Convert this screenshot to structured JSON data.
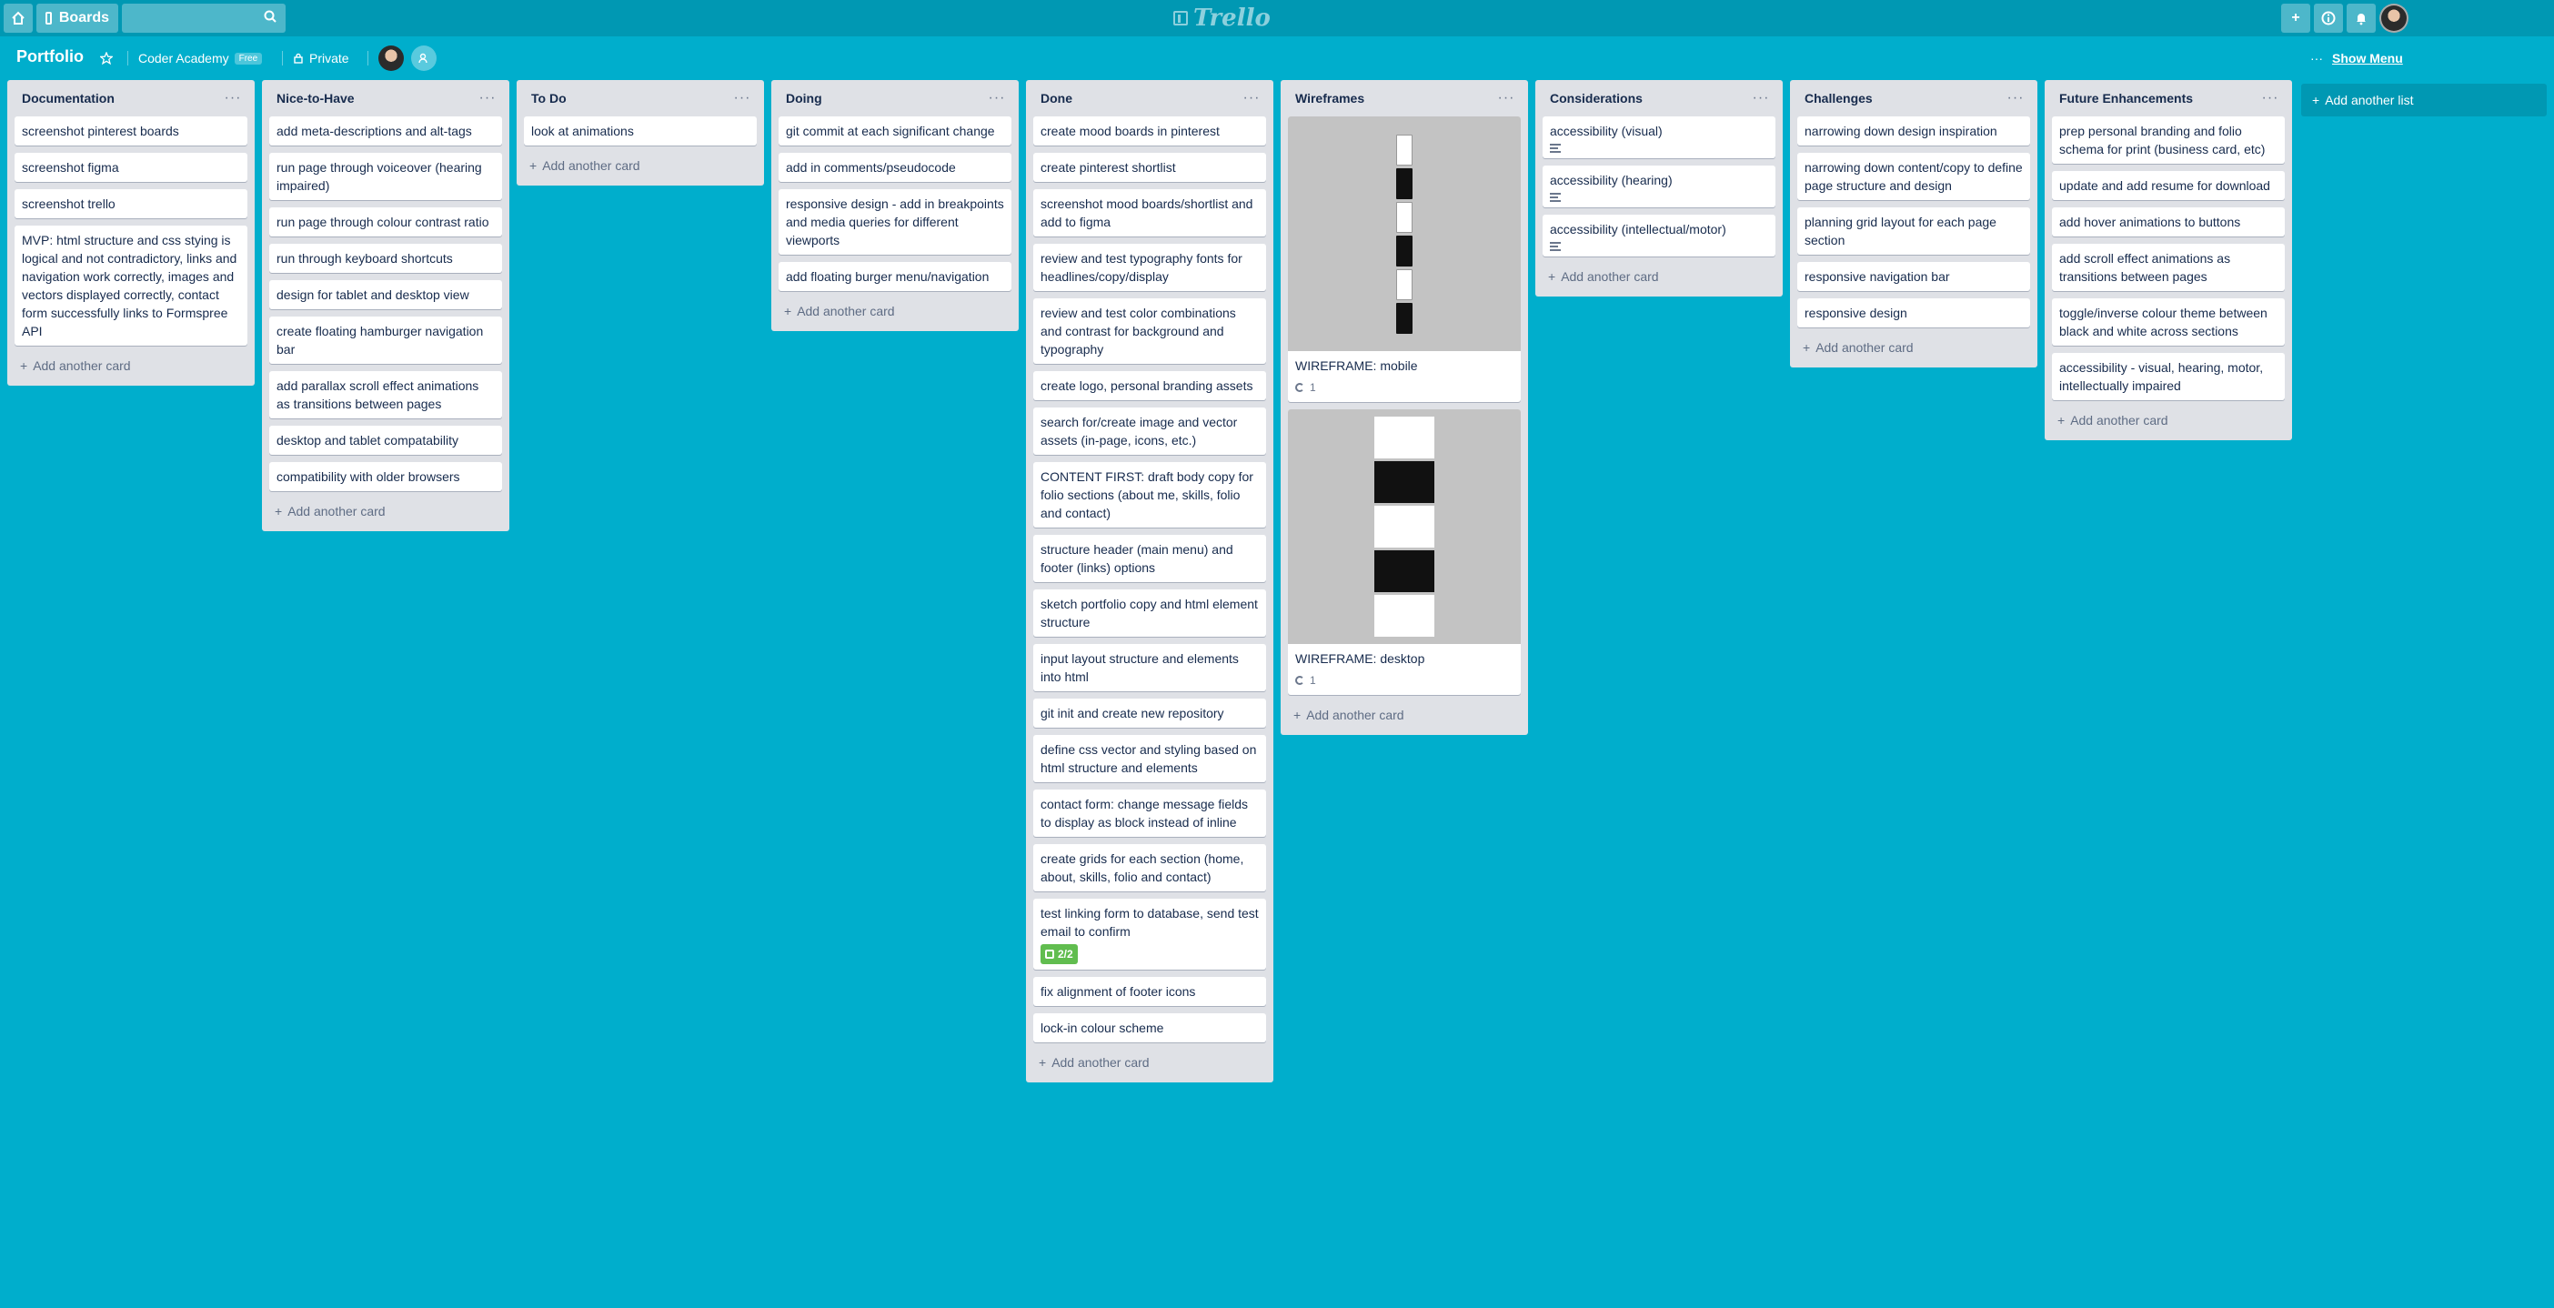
{
  "header": {
    "boards_label": "Boards",
    "search_value": "",
    "logo_text": "Trello"
  },
  "board": {
    "title": "Portfolio",
    "team": "Coder Academy",
    "team_badge": "Free",
    "visibility": "Private",
    "show_menu_label": "Show Menu",
    "show_menu_dots": "···"
  },
  "add_card_label": "Add another card",
  "add_list_label": "Add another list",
  "lists": [
    {
      "title": "Documentation",
      "cards": [
        "screenshot pinterest boards",
        "screenshot figma",
        "screenshot trello",
        "MVP: html structure and css stying is logical and not contradictory, links and navigation work correctly, images and vectors displayed correctly, contact form successfully links to Formspree API"
      ]
    },
    {
      "title": "Nice-to-Have",
      "cards": [
        "add meta-descriptions and alt-tags",
        "run page through voiceover (hearing impaired)",
        "run page through colour contrast ratio",
        "run through keyboard shortcuts",
        "design for tablet and desktop view",
        "create floating hamburger navigation bar",
        "add parallax scroll effect animations as transitions between pages",
        "desktop and tablet compatability",
        "compatibility with older browsers"
      ]
    },
    {
      "title": "To Do",
      "cards": [
        "look at animations"
      ]
    },
    {
      "title": "Doing",
      "cards": [
        "git commit at each significant change",
        "add in comments/pseudocode",
        "responsive design - add in breakpoints and media queries for different viewports",
        "add floating burger menu/navigation"
      ]
    },
    {
      "title": "Done",
      "cards": [
        "create mood boards in pinterest",
        "create pinterest shortlist",
        "screenshot mood boards/shortlist and add to figma",
        "review and test typography fonts for headlines/copy/display",
        "review and test color combinations and contrast for background and typography",
        "create logo, personal branding assets",
        "search for/create image and vector assets (in-page, icons, etc.)",
        "CONTENT FIRST: draft body copy for folio sections (about me, skills, folio and contact)",
        "structure header (main menu) and footer (links) options",
        "sketch portfolio copy and html element structure",
        "input layout structure and elements into html",
        "git init and create new repository",
        "define css vector and styling based on html structure and elements",
        "contact form: change message fields to display as block instead of inline",
        "create grids for each section (home, about, skills, folio and contact)",
        "test linking form to database, send test email to confirm",
        "fix alignment of footer icons",
        "lock-in colour scheme"
      ],
      "checklist": "2/2"
    },
    {
      "title": "Wireframes",
      "cards": [
        "WIREFRAME: mobile",
        "WIREFRAME: desktop"
      ],
      "attachments": [
        "1",
        "1"
      ]
    },
    {
      "title": "Considerations",
      "cards": [
        "accessibility (visual)",
        "accessibility (hearing)",
        "accessibility (intellectual/motor)"
      ]
    },
    {
      "title": "Challenges",
      "cards": [
        "narrowing down design inspiration",
        "narrowing down content/copy to define page structure and design",
        "planning grid layout for each page section",
        "responsive navigation bar",
        "responsive design"
      ]
    },
    {
      "title": "Future Enhancements",
      "cards": [
        "prep personal branding and folio schema for print (business card, etc)",
        "update and add resume for download",
        "add hover animations to buttons",
        "add scroll effect animations as transitions between pages",
        "toggle/inverse colour theme between black and white across sections",
        "accessibility - visual, hearing, motor, intellectually impaired"
      ]
    }
  ],
  "colors": {
    "background": "#00aecc",
    "header": "#0098b3",
    "list": "#dfe1e6",
    "checklist_badge": "#61bd4f"
  }
}
